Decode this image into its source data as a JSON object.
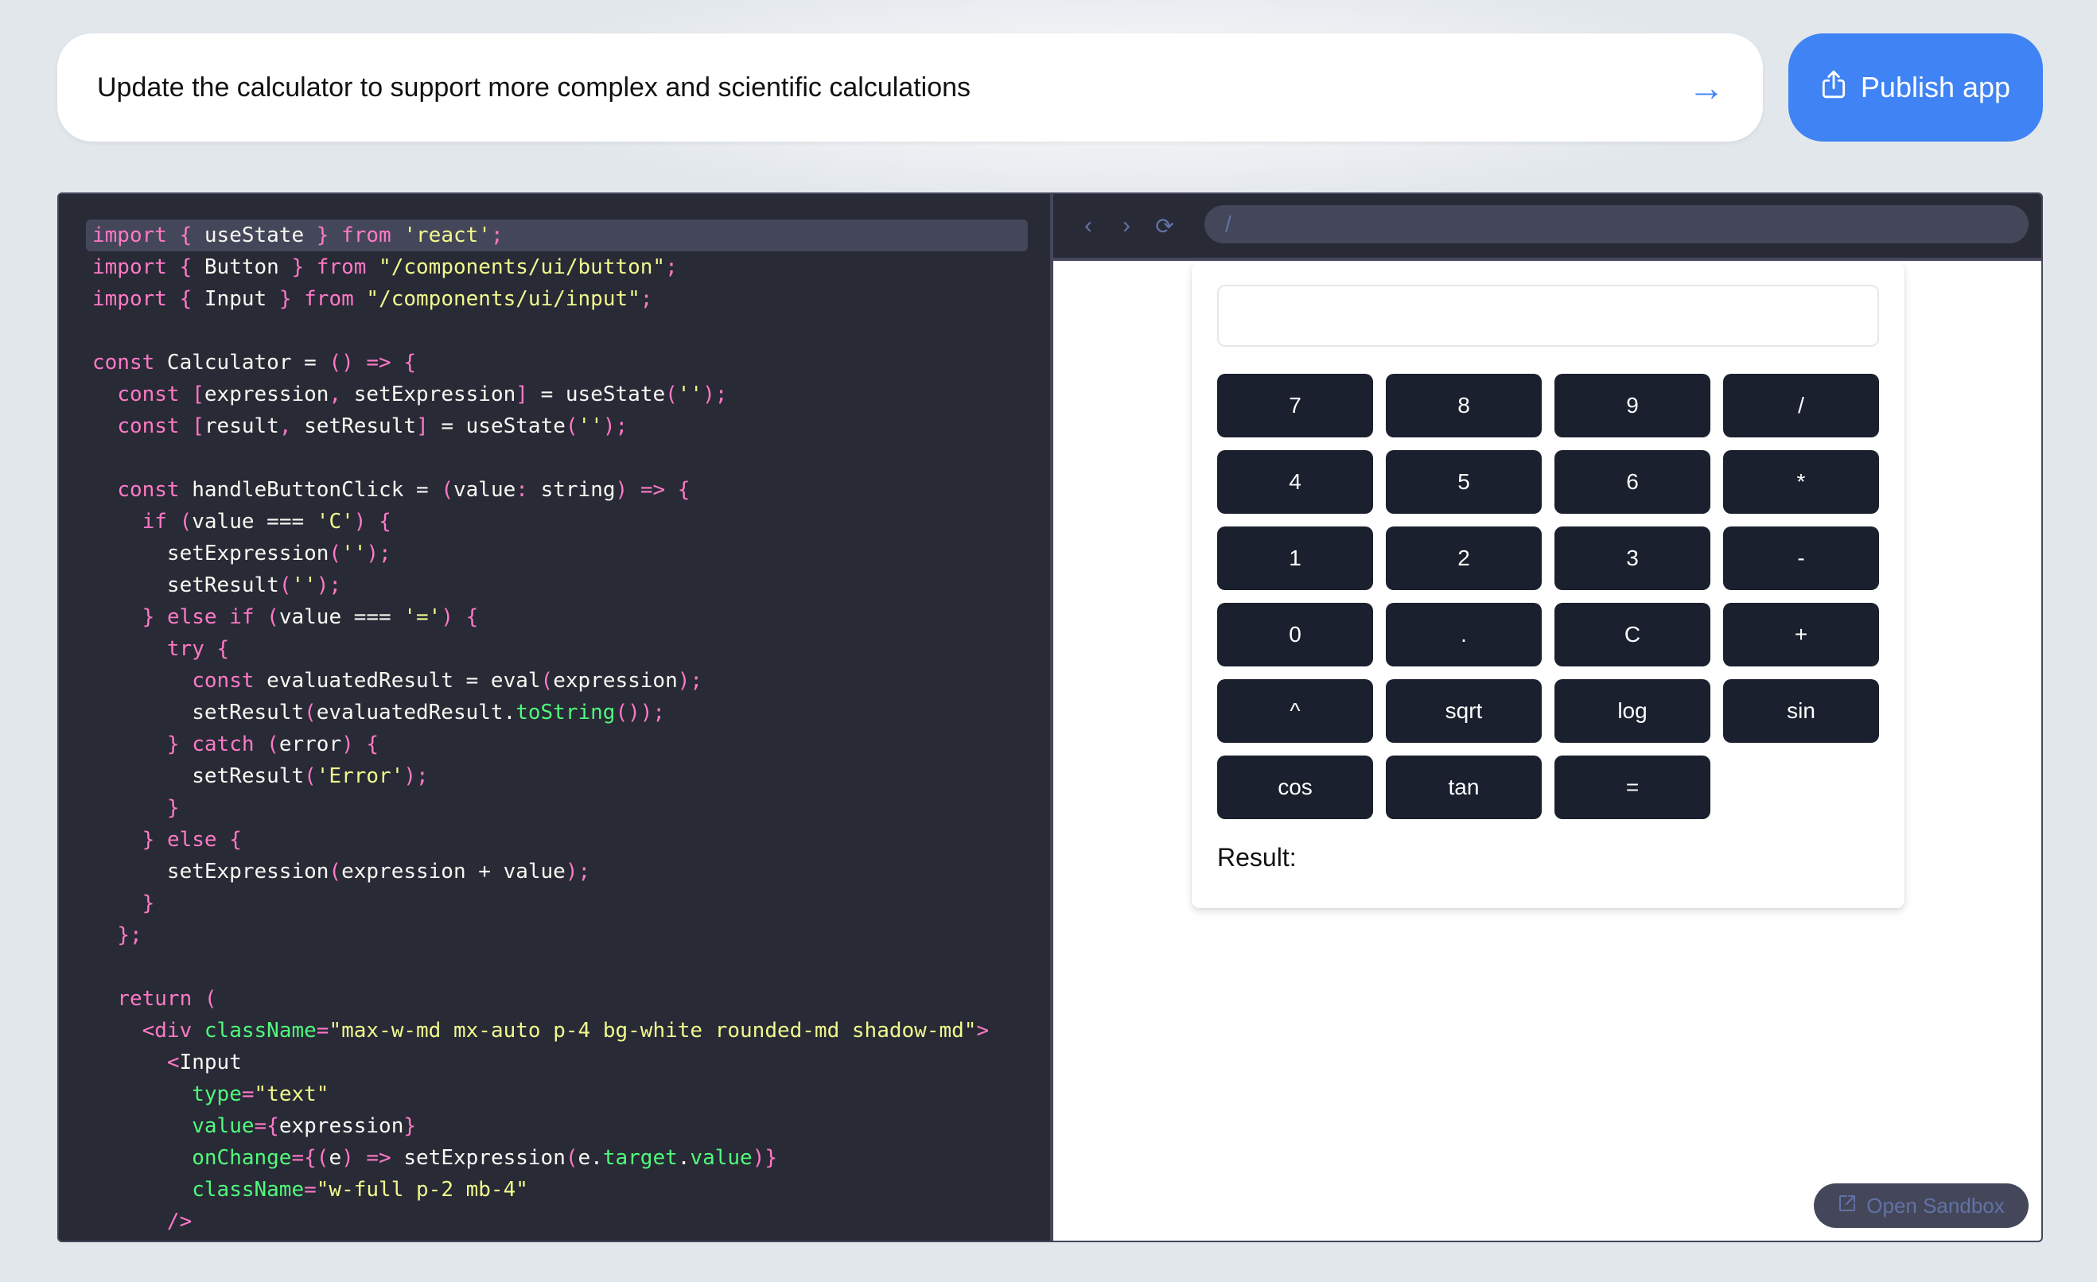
{
  "prompt": {
    "value": "Update the calculator to support more complex and scientific calculations",
    "send_icon": "arrow-right-icon"
  },
  "publish": {
    "label": "Publish app",
    "icon": "share-upload-icon"
  },
  "code": {
    "lines": [
      [
        [
          "k",
          "import"
        ],
        [
          "p",
          " { "
        ],
        [
          "",
          "useState"
        ],
        [
          "p",
          " } "
        ],
        [
          "k",
          "from"
        ],
        [
          "s",
          " 'react'"
        ],
        [
          "p",
          ";"
        ]
      ],
      [
        [
          "k",
          "import"
        ],
        [
          "p",
          " { "
        ],
        [
          "",
          "Button"
        ],
        [
          "p",
          " } "
        ],
        [
          "k",
          "from"
        ],
        [
          "s",
          " \"/components/ui/button\""
        ],
        [
          "p",
          ";"
        ]
      ],
      [
        [
          "k",
          "import"
        ],
        [
          "p",
          " { "
        ],
        [
          "",
          "Input"
        ],
        [
          "p",
          " } "
        ],
        [
          "k",
          "from"
        ],
        [
          "s",
          " \"/components/ui/input\""
        ],
        [
          "p",
          ";"
        ]
      ],
      [],
      [
        [
          "k",
          "const"
        ],
        [
          "",
          " Calculator = "
        ],
        [
          "p",
          "()"
        ],
        [
          "",
          " "
        ],
        [
          "k",
          "=>"
        ],
        [
          "p",
          " {"
        ]
      ],
      [
        [
          "",
          "  "
        ],
        [
          "k",
          "const"
        ],
        [
          "p",
          " ["
        ],
        [
          "",
          "expression"
        ],
        [
          "p",
          ","
        ],
        [
          "",
          " setExpression"
        ],
        [
          "p",
          "]"
        ],
        [
          "",
          " = useState"
        ],
        [
          "p",
          "("
        ],
        [
          "s",
          "''"
        ],
        [
          "p",
          ");"
        ]
      ],
      [
        [
          "",
          "  "
        ],
        [
          "k",
          "const"
        ],
        [
          "p",
          " ["
        ],
        [
          "",
          "result"
        ],
        [
          "p",
          ","
        ],
        [
          "",
          " setResult"
        ],
        [
          "p",
          "]"
        ],
        [
          "",
          " = useState"
        ],
        [
          "p",
          "("
        ],
        [
          "s",
          "''"
        ],
        [
          "p",
          ");"
        ]
      ],
      [],
      [
        [
          "",
          "  "
        ],
        [
          "k",
          "const"
        ],
        [
          "",
          " handleButtonClick = "
        ],
        [
          "p",
          "("
        ],
        [
          "",
          "value"
        ],
        [
          "p",
          ":"
        ],
        [
          "",
          " string"
        ],
        [
          "p",
          ")"
        ],
        [
          "",
          " "
        ],
        [
          "k",
          "=>"
        ],
        [
          "p",
          " {"
        ]
      ],
      [
        [
          "",
          "    "
        ],
        [
          "k",
          "if"
        ],
        [
          "p",
          " ("
        ],
        [
          "",
          "value === "
        ],
        [
          "s",
          "'C'"
        ],
        [
          "p",
          ") {"
        ]
      ],
      [
        [
          "",
          "      setExpression"
        ],
        [
          "p",
          "("
        ],
        [
          "s",
          "''"
        ],
        [
          "p",
          ");"
        ]
      ],
      [
        [
          "",
          "      setResult"
        ],
        [
          "p",
          "("
        ],
        [
          "s",
          "''"
        ],
        [
          "p",
          ");"
        ]
      ],
      [
        [
          "",
          "    "
        ],
        [
          "p",
          "} "
        ],
        [
          "k",
          "else if"
        ],
        [
          "p",
          " ("
        ],
        [
          "",
          "value === "
        ],
        [
          "s",
          "'='"
        ],
        [
          "p",
          ") {"
        ]
      ],
      [
        [
          "",
          "      "
        ],
        [
          "k",
          "try"
        ],
        [
          "p",
          " {"
        ]
      ],
      [
        [
          "",
          "        "
        ],
        [
          "k",
          "const"
        ],
        [
          "",
          " evaluatedResult = eval"
        ],
        [
          "p",
          "("
        ],
        [
          "",
          "expression"
        ],
        [
          "p",
          ");"
        ]
      ],
      [
        [
          "",
          "        setResult"
        ],
        [
          "p",
          "("
        ],
        [
          "",
          "evaluatedResult."
        ],
        [
          "g",
          "toString"
        ],
        [
          "p",
          "());"
        ]
      ],
      [
        [
          "",
          "      "
        ],
        [
          "p",
          "} "
        ],
        [
          "k",
          "catch"
        ],
        [
          "p",
          " ("
        ],
        [
          "",
          "error"
        ],
        [
          "p",
          ") {"
        ]
      ],
      [
        [
          "",
          "        setResult"
        ],
        [
          "p",
          "("
        ],
        [
          "s",
          "'Error'"
        ],
        [
          "p",
          ");"
        ]
      ],
      [
        [
          "",
          "      "
        ],
        [
          "p",
          "}"
        ]
      ],
      [
        [
          "",
          "    "
        ],
        [
          "p",
          "} "
        ],
        [
          "k",
          "else"
        ],
        [
          "p",
          " {"
        ]
      ],
      [
        [
          "",
          "      setExpression"
        ],
        [
          "p",
          "("
        ],
        [
          "",
          "expression + value"
        ],
        [
          "p",
          ");"
        ]
      ],
      [
        [
          "",
          "    "
        ],
        [
          "p",
          "}"
        ]
      ],
      [
        [
          "",
          "  "
        ],
        [
          "p",
          "};"
        ]
      ],
      [],
      [
        [
          "",
          "  "
        ],
        [
          "k",
          "return"
        ],
        [
          "p",
          " ("
        ]
      ],
      [
        [
          "",
          "    "
        ],
        [
          "p",
          "<"
        ],
        [
          "k",
          "div"
        ],
        [
          "",
          " "
        ],
        [
          "g",
          "className"
        ],
        [
          "p",
          "="
        ],
        [
          "s",
          "\"max-w-md mx-auto p-4 bg-white rounded-md shadow-md\""
        ],
        [
          "p",
          ">"
        ]
      ],
      [
        [
          "",
          "      "
        ],
        [
          "p",
          "<"
        ],
        [
          "",
          "Input"
        ]
      ],
      [
        [
          "",
          "        "
        ],
        [
          "g",
          "type"
        ],
        [
          "p",
          "="
        ],
        [
          "s",
          "\"text\""
        ]
      ],
      [
        [
          "",
          "        "
        ],
        [
          "g",
          "value"
        ],
        [
          "p",
          "={"
        ],
        [
          "",
          "expression"
        ],
        [
          "p",
          "}"
        ]
      ],
      [
        [
          "",
          "        "
        ],
        [
          "g",
          "onChange"
        ],
        [
          "p",
          "={("
        ],
        [
          "",
          "e"
        ],
        [
          "p",
          ")"
        ],
        [
          "",
          " "
        ],
        [
          "k",
          "=>"
        ],
        [
          "",
          " setExpression"
        ],
        [
          "p",
          "("
        ],
        [
          "",
          "e."
        ],
        [
          "g",
          "target"
        ],
        [
          "",
          "."
        ],
        [
          "g",
          "value"
        ],
        [
          "p",
          ")}"
        ]
      ],
      [
        [
          "",
          "        "
        ],
        [
          "g",
          "className"
        ],
        [
          "p",
          "="
        ],
        [
          "s",
          "\"w-full p-2 mb-4\""
        ]
      ],
      [
        [
          "",
          "      "
        ],
        [
          "p",
          "/>"
        ]
      ]
    ],
    "active_line": 0
  },
  "preview": {
    "nav": {
      "back_icon": "chevron-left-icon",
      "forward_icon": "chevron-right-icon",
      "reload_icon": "reload-icon"
    },
    "url": "/",
    "calculator": {
      "expression": "",
      "buttons": [
        "7",
        "8",
        "9",
        "/",
        "4",
        "5",
        "6",
        "*",
        "1",
        "2",
        "3",
        "-",
        "0",
        ".",
        "C",
        "+",
        "^",
        "sqrt",
        "log",
        "sin",
        "cos",
        "tan",
        "="
      ],
      "result_label": "Result:",
      "result_value": ""
    },
    "open_sandbox": {
      "label": "Open Sandbox",
      "icon": "external-link-icon"
    }
  },
  "colors": {
    "accent": "#3f83f4",
    "editor_bg": "#282a36",
    "keyword": "#ff79c6",
    "string": "#f1fa8c",
    "attribute": "#50fa7b",
    "calc_button": "#1a202d"
  }
}
